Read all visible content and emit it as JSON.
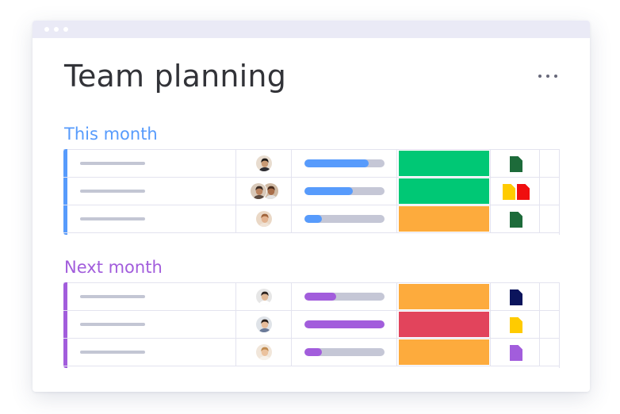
{
  "window": {
    "controls": [
      "dot",
      "dot",
      "dot"
    ]
  },
  "board": {
    "title": "Team planning",
    "menu_icon": "more-horizontal-icon"
  },
  "colors": {
    "group_this_month": "#579bfc",
    "group_next_month": "#a25ddc",
    "status_green": "#00c875",
    "status_orange": "#fdab3d",
    "status_red": "#e2445c",
    "progress_blue": "#579bfc",
    "progress_purple": "#a25ddc",
    "progress_track": "#c5c7d6"
  },
  "groups": [
    {
      "title": "This month",
      "color": "#579bfc",
      "rows": [
        {
          "avatars": [
            "person-man-dark-hair"
          ],
          "progress": 0.8,
          "progress_color": "#579bfc",
          "status_color": "#00c875",
          "files": [
            {
              "icon": "green-file-icon",
              "color": "#1d6b3a"
            }
          ]
        },
        {
          "avatars": [
            "person-man-beard",
            "person-woman-curly"
          ],
          "progress": 0.6,
          "progress_color": "#579bfc",
          "status_color": "#00c875",
          "files": [
            {
              "icon": "yellow-file-icon",
              "color": "#ffcb00"
            },
            {
              "icon": "red-file-icon",
              "color": "#f00f0f"
            }
          ]
        },
        {
          "avatars": [
            "person-woman-light-hair"
          ],
          "progress": 0.22,
          "progress_color": "#579bfc",
          "status_color": "#fdab3d",
          "files": [
            {
              "icon": "green-file-icon",
              "color": "#1d6b3a"
            }
          ]
        }
      ]
    },
    {
      "title": "Next month",
      "color": "#a25ddc",
      "rows": [
        {
          "avatars": [
            "person-man-light"
          ],
          "progress": 0.4,
          "progress_color": "#a25ddc",
          "status_color": "#fdab3d",
          "files": [
            {
              "icon": "navy-file-icon",
              "color": "#0b145c"
            }
          ]
        },
        {
          "avatars": [
            "person-woman-dark-hair"
          ],
          "progress": 1.0,
          "progress_color": "#a25ddc",
          "status_color": "#e2445c",
          "files": [
            {
              "icon": "yellow-file-icon",
              "color": "#ffcb00"
            }
          ]
        },
        {
          "avatars": [
            "person-woman-blonde"
          ],
          "progress": 0.22,
          "progress_color": "#a25ddc",
          "status_color": "#fdab3d",
          "files": [
            {
              "icon": "purple-file-icon",
              "color": "#a25ddc"
            }
          ]
        }
      ]
    }
  ]
}
